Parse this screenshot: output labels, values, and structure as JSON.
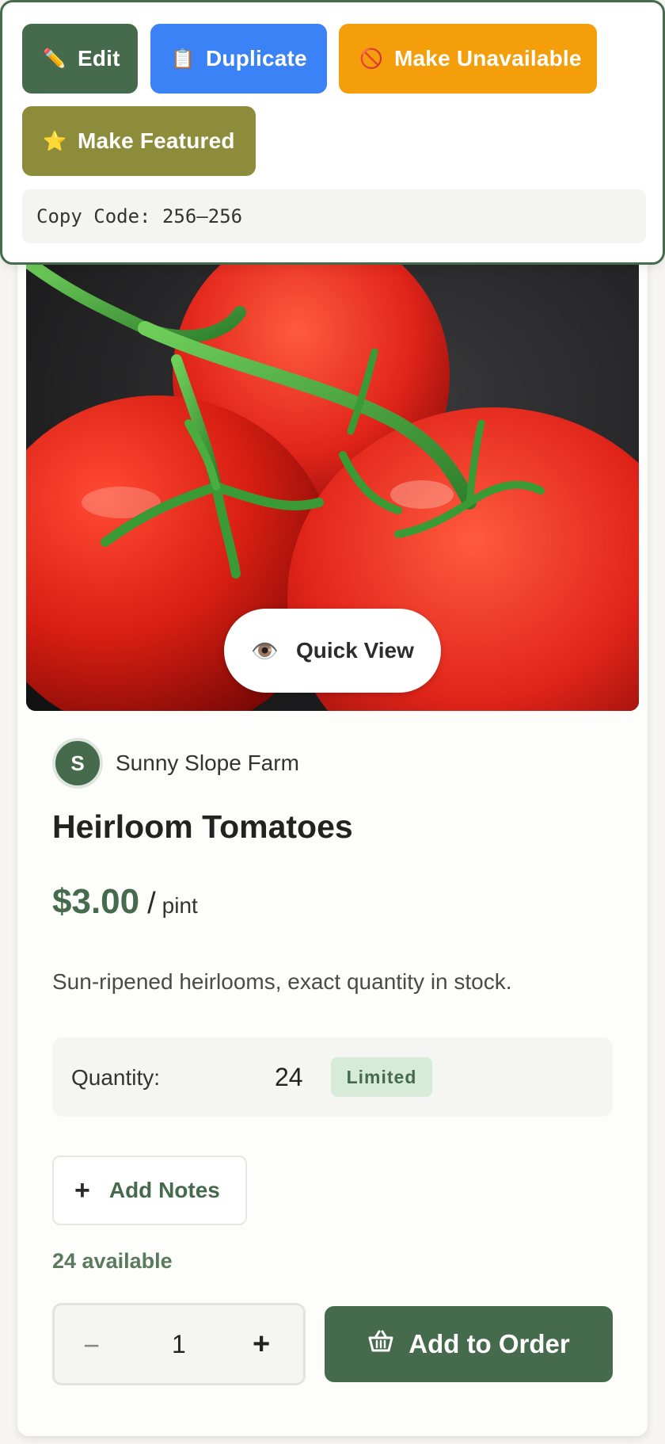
{
  "admin": {
    "edit_label": "Edit",
    "duplicate_label": "Duplicate",
    "make_unavailable_label": "Make Unavailable",
    "make_featured_label": "Make Featured",
    "copy_code": "Copy Code: 256–256",
    "edit_icon": "✏️",
    "duplicate_icon": "📋",
    "unavailable_icon": "🚫",
    "featured_icon": "⭐"
  },
  "product": {
    "quick_view_label": "Quick View",
    "quick_view_icon": "👁️",
    "farm_initial": "S",
    "farm_name": "Sunny Slope Farm",
    "title": "Heirloom Tomatoes",
    "price": "$3.00",
    "price_separator": "/",
    "unit": "pint",
    "description": "Sun-ripened heirlooms, exact quantity in stock.",
    "quantity_label": "Quantity:",
    "quantity_value": "24",
    "stock_badge": "Limited",
    "add_notes_label": "Add Notes",
    "add_notes_icon": "+",
    "available_text": "24 available",
    "stepper_minus": "−",
    "stepper_value": "1",
    "stepper_plus": "+",
    "add_to_order_label": "Add to Order"
  },
  "colors": {
    "brand_green": "#456b4c",
    "duplicate_blue": "#3b82f6",
    "unavailable_orange": "#f59e0b",
    "featured_olive": "#8c8c3a",
    "badge_bg": "#d6ecd9"
  }
}
